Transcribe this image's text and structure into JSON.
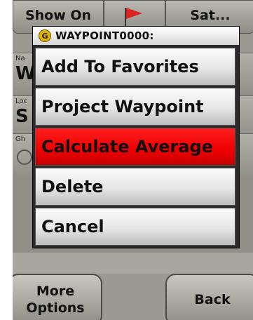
{
  "background": {
    "tabs": [
      {
        "label": "Show On"
      },
      {
        "icon": "flag-icon"
      },
      {
        "label": "Sat..."
      }
    ],
    "rows": [
      {
        "label": "Na",
        "value": "W"
      },
      {
        "label": "Loc",
        "value": "S"
      },
      {
        "label": "Gh",
        "icon": "waypoint-icon"
      }
    ],
    "buttons": {
      "more_options": "More\nOptions",
      "back": "Back"
    }
  },
  "modal": {
    "title": "WAYPOINT0000:",
    "title_icon": "G",
    "items": [
      {
        "label": "Add To Favorites"
      },
      {
        "label": "Project Waypoint"
      },
      {
        "label": "Calculate Average",
        "selected": true
      },
      {
        "label": "Delete"
      },
      {
        "label": "Cancel"
      }
    ]
  },
  "colors": {
    "selected": "#ff0000",
    "title_icon": "#e3b300"
  }
}
